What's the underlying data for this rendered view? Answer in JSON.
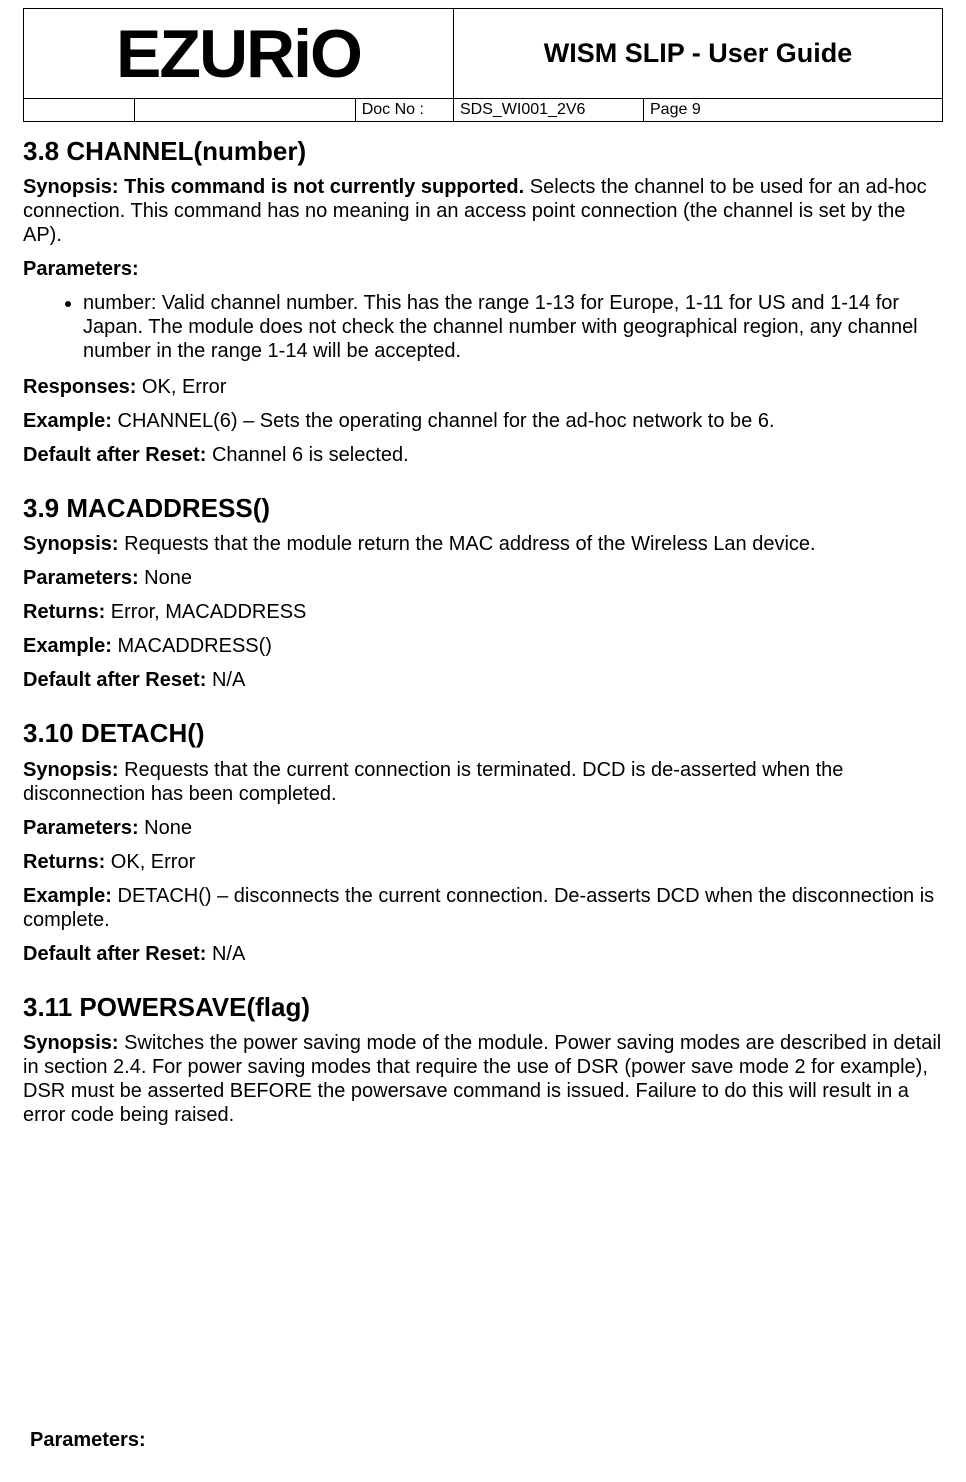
{
  "header": {
    "logo_text": "EZURiO",
    "title": "WISM SLIP - User Guide",
    "docno_label": "Doc No :",
    "docno_value": "SDS_WI001_2V6",
    "page_label": "Page 9"
  },
  "s38": {
    "heading": "3.8  CHANNEL(number)",
    "synopsis_label": "Synopsis: This command is not currently supported.",
    "synopsis_rest": " Selects the channel to be used for an ad-hoc connection. This command has no meaning in an access point connection (the channel is set by the AP).",
    "parameters_label": "Parameters:",
    "param_bullet": "number: Valid channel number. This has the range 1-13 for Europe, 1-11 for US and 1-14 for Japan. The module does not check the channel number with geographical region, any channel number in the range 1-14 will be accepted.",
    "responses_label": "Responses:",
    "responses_value": " OK, Error",
    "example_label": "Example:",
    "example_value": " CHANNEL(6) – Sets the operating channel for the ad-hoc network to be 6.",
    "reset_label": "Default after Reset:",
    "reset_value": " Channel 6 is selected."
  },
  "s39": {
    "heading": "3.9  MACADDRESS()",
    "synopsis_label": "Synopsis:",
    "synopsis_value": " Requests that the module return the MAC address of the Wireless Lan device.",
    "parameters_label": "Parameters:",
    "parameters_value": " None",
    "returns_label": "Returns:",
    "returns_value": " Error, MACADDRESS",
    "example_label": "Example:",
    "example_value": " MACADDRESS()",
    "reset_label": "Default after Reset:",
    "reset_value": " N/A"
  },
  "s310": {
    "heading": "3.10  DETACH()",
    "synopsis_label": "Synopsis:",
    "synopsis_value": " Requests that the current connection is terminated. DCD is de-asserted when the disconnection has been completed.",
    "parameters_label": "Parameters:",
    "parameters_value": " None",
    "returns_label": "Returns:",
    "returns_value": " OK, Error",
    "example_label": "Example:",
    "example_value": " DETACH() – disconnects the current connection. De-asserts DCD when the disconnection is complete.",
    "reset_label": "Default after Reset:",
    "reset_value": " N/A"
  },
  "s311": {
    "heading": "3.11  POWERSAVE(flag)",
    "synopsis_label": "Synopsis:",
    "synopsis_value": " Switches the power saving mode of the module. Power saving modes are described in detail in section 2.4. For power saving modes that require the use of DSR (power save mode 2 for example), DSR must be asserted BEFORE the powersave command is issued. Failure to do this will result in a error code being raised."
  },
  "bottom": {
    "parameters_label": "Parameters:"
  }
}
